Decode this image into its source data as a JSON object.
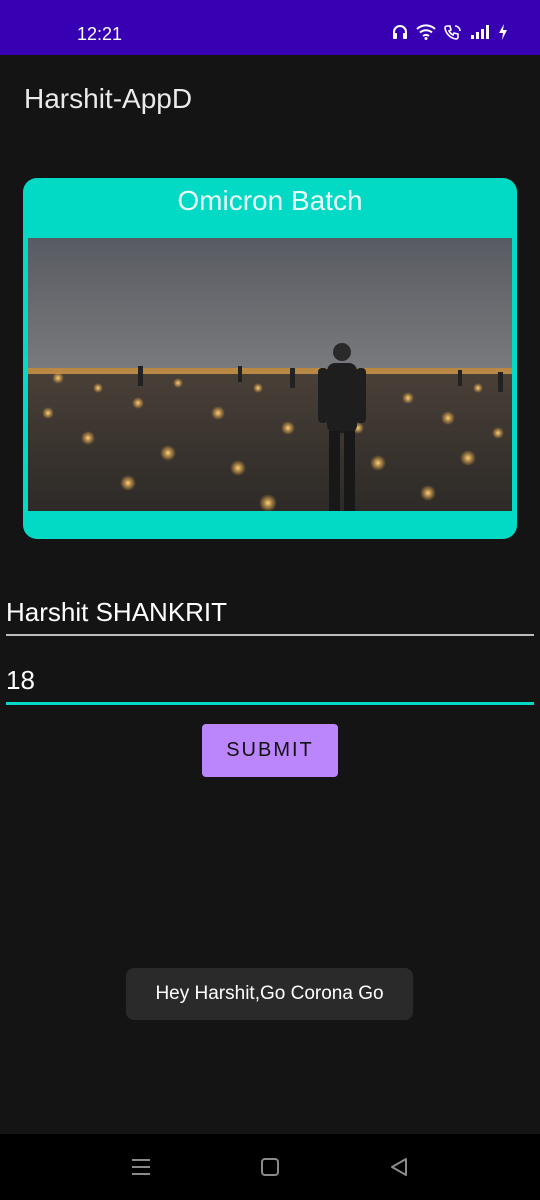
{
  "status_bar": {
    "time": "12:21",
    "icons": [
      "headset-icon",
      "wifi-icon",
      "wifi-call-icon",
      "signal-icon",
      "charging-icon"
    ]
  },
  "app_bar": {
    "title": "Harshit-AppD"
  },
  "card": {
    "title": "Omicron Batch",
    "background_color": "#03dac5",
    "photo": "person-standing-on-beach-with-lamps-photo"
  },
  "form": {
    "name_value": "Harshit SHANKRIT",
    "age_value": "18",
    "submit_label": "SUBMIT",
    "accent_color": "#03dac5",
    "button_color": "#bb86fc"
  },
  "toast": {
    "message": "Hey Harshit,Go Corona Go"
  },
  "nav_bar": {
    "icons": [
      "recents-icon",
      "home-icon",
      "back-icon"
    ]
  },
  "colors": {
    "status_bar": "#3700b3",
    "background": "#141414"
  }
}
